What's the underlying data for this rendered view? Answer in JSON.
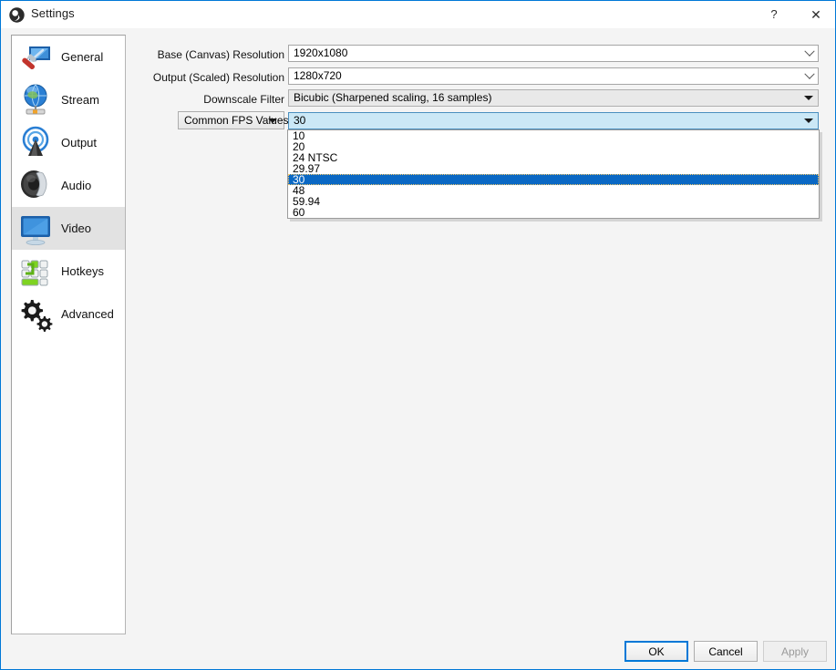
{
  "window": {
    "title": "Settings",
    "app_icon": "obs-logo-icon",
    "help_label": "?",
    "close_label": "✕",
    "accent_color": "#0078d7",
    "background_color": "#f4f4f4"
  },
  "sidebar": {
    "items": [
      {
        "label": "General",
        "icon": "general-icon",
        "selected": false
      },
      {
        "label": "Stream",
        "icon": "stream-icon",
        "selected": false
      },
      {
        "label": "Output",
        "icon": "output-icon",
        "selected": false
      },
      {
        "label": "Audio",
        "icon": "audio-icon",
        "selected": false
      },
      {
        "label": "Video",
        "icon": "video-icon",
        "selected": true
      },
      {
        "label": "Hotkeys",
        "icon": "hotkeys-icon",
        "selected": false
      },
      {
        "label": "Advanced",
        "icon": "advanced-icon",
        "selected": false
      }
    ]
  },
  "video_settings": {
    "base_resolution": {
      "label": "Base (Canvas) Resolution",
      "value": "1920x1080",
      "arrow": "chevron-down-icon"
    },
    "output_resolution": {
      "label": "Output (Scaled) Resolution",
      "value": "1280x720",
      "arrow": "chevron-down-icon"
    },
    "downscale_filter": {
      "label": "Downscale Filter",
      "value": "Bicubic (Sharpened scaling, 16 samples)",
      "arrow": "triangle-down-icon"
    },
    "fps_type": {
      "label": "Common FPS Values",
      "arrow": "triangle-down-icon"
    },
    "fps_value": {
      "value": "30",
      "arrow": "triangle-down-icon",
      "options": [
        "10",
        "20",
        "24 NTSC",
        "29.97",
        "30",
        "48",
        "59.94",
        "60"
      ],
      "selected_index": 4,
      "highlight_color": "#0a68c4"
    }
  },
  "footer": {
    "ok_label": "OK",
    "cancel_label": "Cancel",
    "apply_label": "Apply",
    "apply_disabled": true
  }
}
